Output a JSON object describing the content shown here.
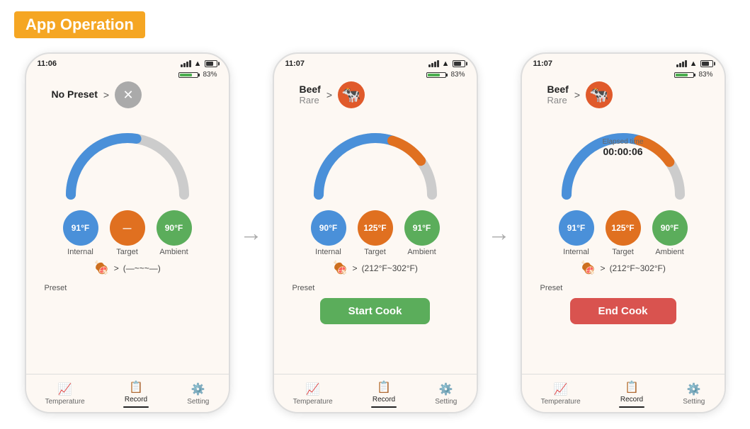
{
  "header": {
    "title": "App Operation"
  },
  "phones": [
    {
      "id": "phone1",
      "status_time": "11:06",
      "battery_pct": "83%",
      "preset": {
        "label_top": "No Preset",
        "label_sub": "",
        "arrow": ">",
        "icon": "✕",
        "icon_style": "gray"
      },
      "temps": [
        {
          "value": "91°F",
          "label": "Internal",
          "style": "blue"
        },
        {
          "value": "—",
          "label": "Target",
          "style": "orange"
        },
        {
          "value": "90°F",
          "label": "Ambient",
          "style": "green"
        }
      ],
      "grill_range": "(—~~~—)",
      "show_button": false,
      "elapsed": null,
      "gauge_blue_pct": 0.55,
      "gauge_gray_pct": 0.45
    },
    {
      "id": "phone2",
      "status_time": "11:07",
      "battery_pct": "83%",
      "preset": {
        "label_top": "Beef",
        "label_sub": "Rare",
        "arrow": ">",
        "icon": "🐄",
        "icon_style": "red"
      },
      "temps": [
        {
          "value": "90°F",
          "label": "Internal",
          "style": "blue"
        },
        {
          "value": "125°F",
          "label": "Target",
          "style": "orange"
        },
        {
          "value": "91°F",
          "label": "Ambient",
          "style": "green"
        }
      ],
      "grill_range": "(212°F~302°F)",
      "show_button": true,
      "button_label": "Start Cook",
      "button_style": "green",
      "elapsed": null,
      "gauge_blue_pct": 0.6,
      "gauge_orange_pct": 0.2
    },
    {
      "id": "phone3",
      "status_time": "11:07",
      "battery_pct": "83%",
      "preset": {
        "label_top": "Beef",
        "label_sub": "Rare",
        "arrow": ">",
        "icon": "🐄",
        "icon_style": "red"
      },
      "temps": [
        {
          "value": "91°F",
          "label": "Internal",
          "style": "blue"
        },
        {
          "value": "125°F",
          "label": "Target",
          "style": "orange"
        },
        {
          "value": "90°F",
          "label": "Ambient",
          "style": "green"
        }
      ],
      "grill_range": "(212°F~302°F)",
      "show_button": true,
      "button_label": "End Cook",
      "button_style": "red",
      "elapsed": {
        "label": "Elapsed time",
        "value": "00:00:06"
      },
      "gauge_blue_pct": 0.6,
      "gauge_orange_pct": 0.22
    }
  ],
  "nav_items": [
    {
      "icon": "📈",
      "label": "Temperature",
      "active": false
    },
    {
      "icon": "📋",
      "label": "Record",
      "active": true
    },
    {
      "icon": "⚙️",
      "label": "Setting",
      "active": false
    }
  ],
  "arrow_label": "→"
}
